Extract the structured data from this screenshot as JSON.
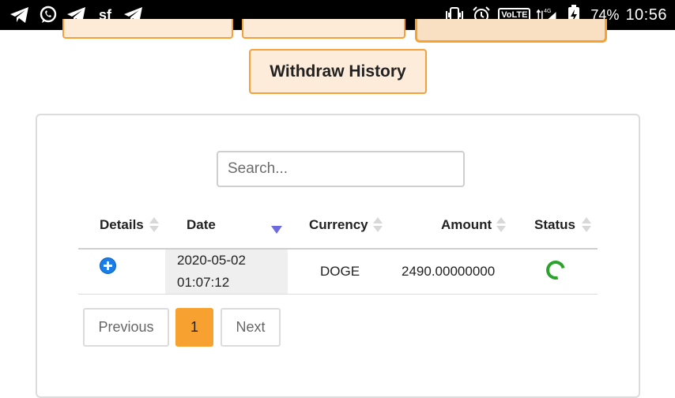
{
  "status_bar": {
    "left_icons": [
      "telegram-icon",
      "whatsapp-icon",
      "telegram-icon",
      "sf-app-icon",
      "telegram-icon"
    ],
    "sf_label": "sf",
    "network_label": "4G",
    "volte_label": "VoLTE",
    "battery": "74%",
    "time": "10:56"
  },
  "actions": {
    "withdraw_history": "Withdraw History"
  },
  "search": {
    "placeholder": "Search...",
    "value": ""
  },
  "table": {
    "columns": [
      "Details",
      "Date",
      "Currency",
      "Amount",
      "Status"
    ],
    "sorted_column": "Date",
    "rows": [
      {
        "date_line1": "2020-05-02",
        "date_line2": "01:07:12",
        "currency": "DOGE",
        "amount": "2490.00000000",
        "status": "pending-spinner"
      }
    ]
  },
  "pagination": {
    "previous": "Previous",
    "current": "1",
    "next": "Next"
  },
  "colors": {
    "accent": "#f7a131",
    "button_bg": "#fdecd9",
    "plus_icon": "#1a7ee6",
    "status_green": "#29a329",
    "sort_active": "#6c6ce0"
  }
}
